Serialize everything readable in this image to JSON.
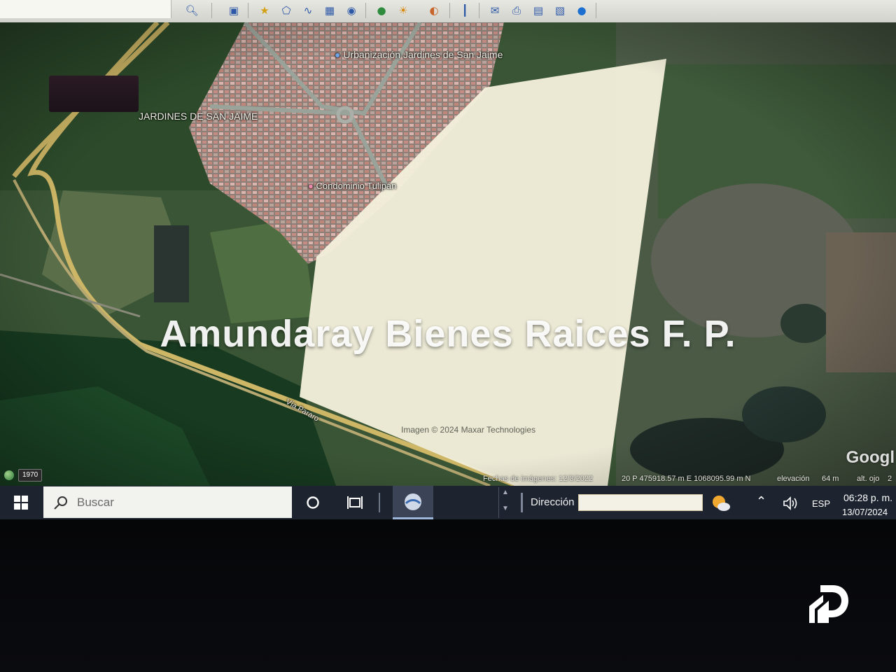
{
  "toolbar": {
    "buttons": [
      "search-icon",
      "sidebar-icon",
      "placemark-icon",
      "polygon-icon",
      "path-icon",
      "overlay-icon",
      "tour-icon",
      "earth-icon",
      "sun-icon",
      "planet-icon",
      "ruler-icon",
      "email-icon",
      "print-icon",
      "save-image-icon",
      "map-icon",
      "globe-icon"
    ]
  },
  "map": {
    "labels": {
      "urbanizacion": "Urbanización Jardines de San Jaime",
      "jardines": "JARDINES DE SAN JAIME",
      "condominio": "Condominio Tulipán",
      "via": "Vía Pararo"
    },
    "watermark": "Amundaray Bienes Raices F. P.",
    "imagery_credit": "Imagen © 2024 Maxar Technologies",
    "google_logo": "Googl",
    "year_badge": "1970",
    "status": {
      "image_date": "Fechas de imágenes: 12/3/2022",
      "coordinates": "20 P 475918.57 m E 1068095.99 m N",
      "elevation_label": "elevación",
      "elevation_value": "64 m",
      "eye_alt_label": "alt. ojo",
      "eye_alt_value": "2"
    }
  },
  "taskbar": {
    "search_placeholder": "Buscar",
    "address_label": "Dirección",
    "address_value": "",
    "language": "ESP",
    "time": "06:28 p. m.",
    "date": "13/07/2024"
  },
  "colors": {
    "parcel_fill": "#f2efdb",
    "taskbar_bg": "#1d2430",
    "toolbar_bg": "#dcdcd6"
  }
}
